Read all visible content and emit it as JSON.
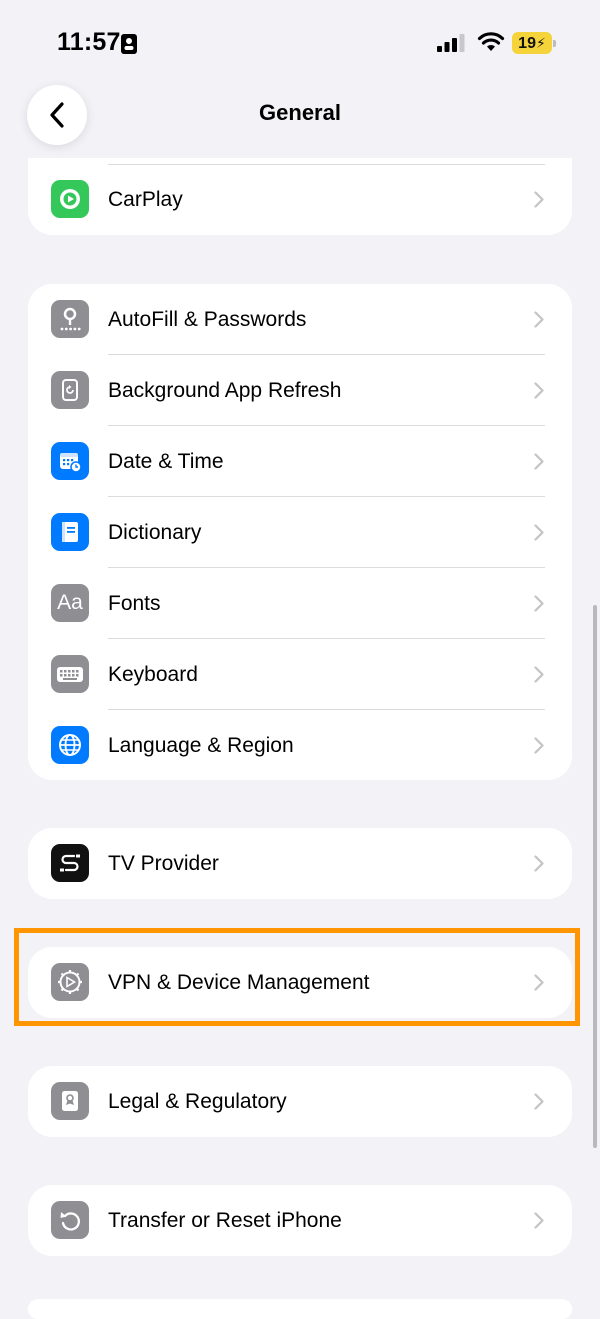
{
  "status_bar": {
    "time": "11:57",
    "battery": "19"
  },
  "header": {
    "title": "General"
  },
  "groups": [
    {
      "items": [
        {
          "label": "CarPlay",
          "icon": "carplay-icon",
          "color": "#34c759"
        }
      ]
    },
    {
      "items": [
        {
          "label": "AutoFill & Passwords",
          "icon": "key-icon",
          "color": "#8e8e93"
        },
        {
          "label": "Background App Refresh",
          "icon": "refresh-icon",
          "color": "#8e8e93"
        },
        {
          "label": "Date & Time",
          "icon": "calendar-clock-icon",
          "color": "#007aff"
        },
        {
          "label": "Dictionary",
          "icon": "book-icon",
          "color": "#007aff"
        },
        {
          "label": "Fonts",
          "icon": "fonts-icon",
          "color": "#8e8e93"
        },
        {
          "label": "Keyboard",
          "icon": "keyboard-icon",
          "color": "#8e8e93"
        },
        {
          "label": "Language & Region",
          "icon": "globe-icon",
          "color": "#007aff"
        }
      ]
    },
    {
      "items": [
        {
          "label": "TV Provider",
          "icon": "tv-provider-icon",
          "color": "#111111"
        }
      ]
    },
    {
      "items": [
        {
          "label": "VPN & Device Management",
          "icon": "gear-icon",
          "color": "#8e8e93"
        }
      ]
    },
    {
      "items": [
        {
          "label": "Legal & Regulatory",
          "icon": "legal-document-icon",
          "color": "#8e8e93"
        }
      ]
    },
    {
      "items": [
        {
          "label": "Transfer or Reset iPhone",
          "icon": "reset-icon",
          "color": "#8e8e93"
        }
      ]
    }
  ],
  "colors": {
    "background": "#f2f2f7",
    "highlight": "#ff9500",
    "battery": "#f5d33b"
  }
}
